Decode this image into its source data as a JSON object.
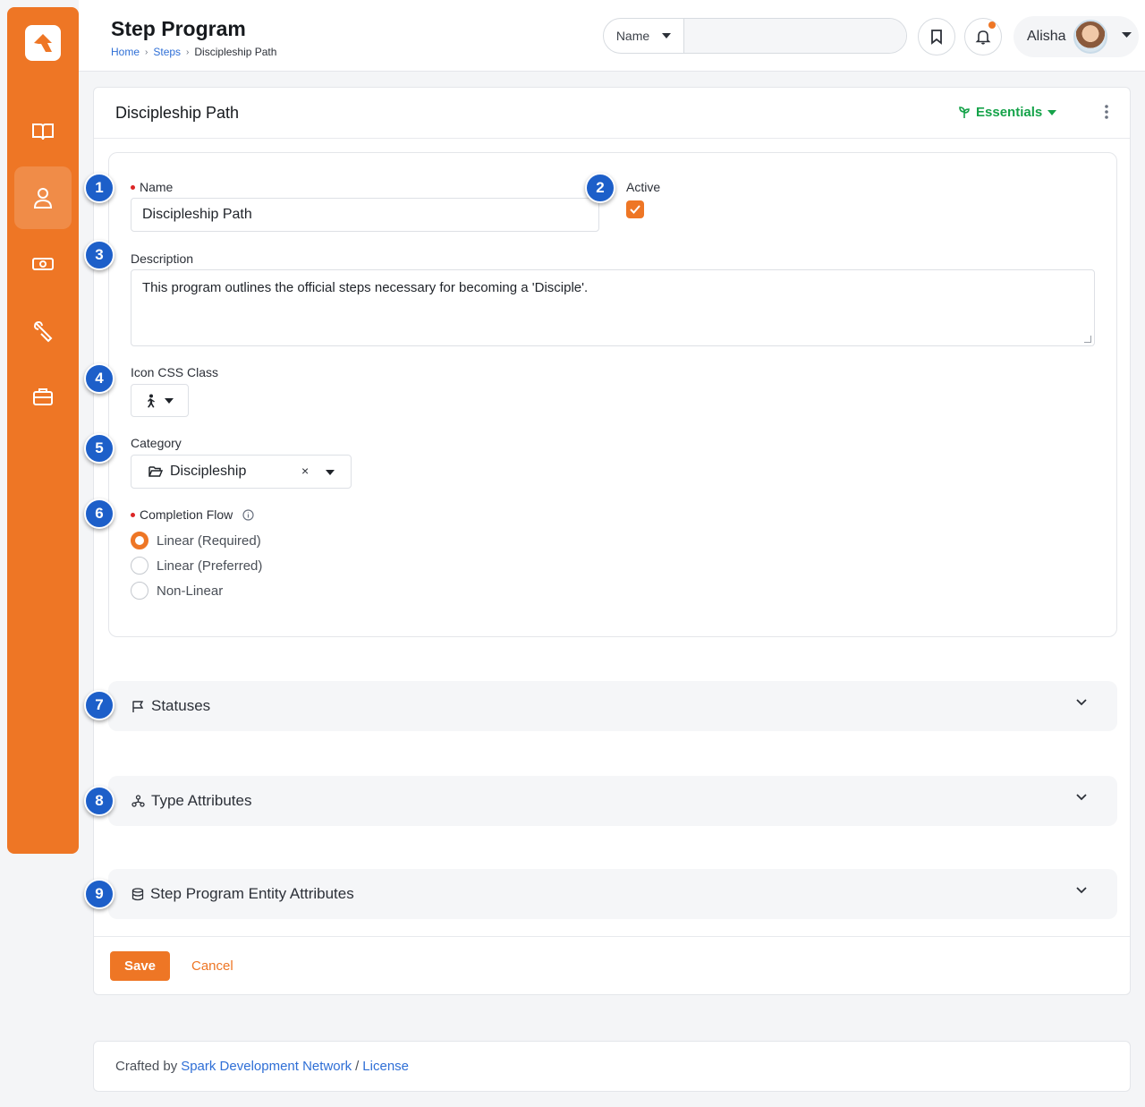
{
  "header": {
    "title": "Step Program",
    "breadcrumb": [
      "Home",
      "Steps",
      "Discipleship Path"
    ],
    "search_type": "Name",
    "user_name": "Alisha"
  },
  "card": {
    "title": "Discipleship Path",
    "essentials_label": "Essentials"
  },
  "form": {
    "name_label": "Name",
    "name_value": "Discipleship Path",
    "active_label": "Active",
    "active_checked": true,
    "description_label": "Description",
    "description_value": "This program outlines the official steps necessary for becoming a 'Disciple'.",
    "icon_label": "Icon CSS Class",
    "category_label": "Category",
    "category_value": "Discipleship",
    "completion_label": "Completion Flow",
    "completion_options": [
      "Linear (Required)",
      "Linear (Preferred)",
      "Non-Linear"
    ],
    "completion_selected": "Linear (Required)"
  },
  "sections": [
    "Statuses",
    "Type Attributes",
    "Step Program Entity Attributes"
  ],
  "actions": {
    "save": "Save",
    "cancel": "Cancel"
  },
  "footer": {
    "prefix": "Crafted by",
    "org": "Spark Development Network",
    "sep": "/",
    "license": "License"
  },
  "callouts": [
    "1",
    "2",
    "3",
    "4",
    "5",
    "6",
    "7",
    "8",
    "9"
  ],
  "colors": {
    "accent": "#ee7625",
    "link": "#2f6fd6",
    "callout": "#1d5fc9",
    "essentials": "#16a34a"
  }
}
